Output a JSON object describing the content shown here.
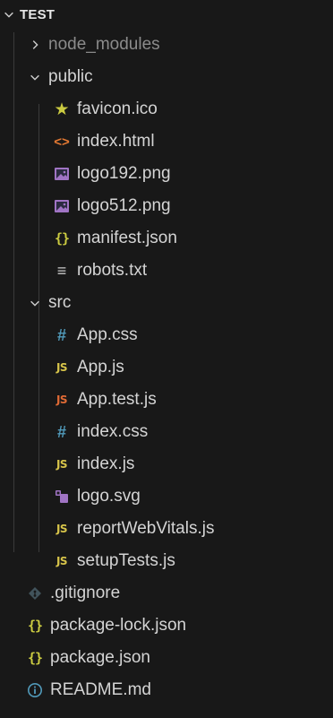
{
  "explorer": {
    "root": "TEST",
    "items": [
      {
        "name": "node_modules",
        "type": "folder",
        "state": "collapsed",
        "icon": "chevron-right-icon"
      },
      {
        "name": "public",
        "type": "folder",
        "state": "expanded",
        "icon": "chevron-down-icon"
      },
      {
        "name": "favicon.ico",
        "type": "file",
        "icon": "star-icon"
      },
      {
        "name": "index.html",
        "type": "file",
        "icon": "html-icon"
      },
      {
        "name": "logo192.png",
        "type": "file",
        "icon": "image-icon"
      },
      {
        "name": "logo512.png",
        "type": "file",
        "icon": "image-icon"
      },
      {
        "name": "manifest.json",
        "type": "file",
        "icon": "json-icon"
      },
      {
        "name": "robots.txt",
        "type": "file",
        "icon": "text-file-icon"
      },
      {
        "name": "src",
        "type": "folder",
        "state": "expanded",
        "icon": "chevron-down-icon"
      },
      {
        "name": "App.css",
        "type": "file",
        "icon": "css-icon"
      },
      {
        "name": "App.js",
        "type": "file",
        "icon": "js-icon"
      },
      {
        "name": "App.test.js",
        "type": "file",
        "icon": "js-test-icon"
      },
      {
        "name": "index.css",
        "type": "file",
        "icon": "css-icon"
      },
      {
        "name": "index.js",
        "type": "file",
        "icon": "js-icon"
      },
      {
        "name": "logo.svg",
        "type": "file",
        "icon": "svg-icon"
      },
      {
        "name": "reportWebVitals.js",
        "type": "file",
        "icon": "js-icon"
      },
      {
        "name": "setupTests.js",
        "type": "file",
        "icon": "js-icon"
      },
      {
        "name": ".gitignore",
        "type": "file",
        "icon": "git-icon"
      },
      {
        "name": "package-lock.json",
        "type": "file",
        "icon": "json-icon"
      },
      {
        "name": "package.json",
        "type": "file",
        "icon": "json-icon"
      },
      {
        "name": "README.md",
        "type": "file",
        "icon": "info-icon"
      }
    ]
  },
  "glyphs": {
    "js": "JS",
    "css": "#",
    "json": "{}",
    "html": "<>",
    "star": "★",
    "txt": "≡"
  },
  "colors": {
    "background": "#181818",
    "text": "#d4d4d4",
    "dim_text": "#8b8b8b",
    "js": "#d7c44a",
    "js_test": "#e06a35",
    "css": "#519aba",
    "json": "#cbcb41",
    "html": "#e37933",
    "image": "#a074c4",
    "git": "#41535b",
    "info": "#519aba"
  }
}
